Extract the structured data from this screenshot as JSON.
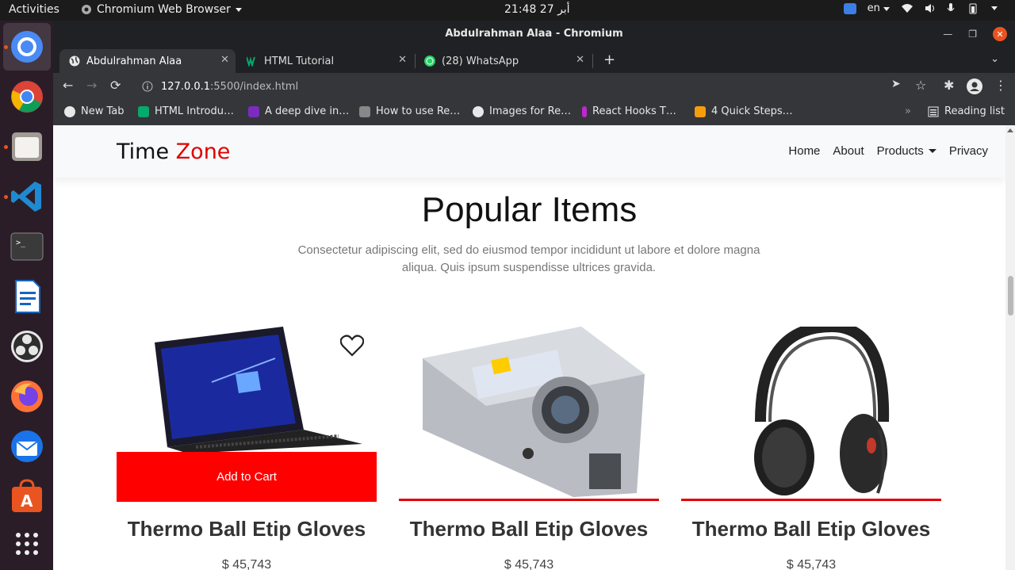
{
  "system": {
    "activities": "Activities",
    "app_menu": "Chromium Web Browser",
    "clock": "21:48  27 أبر",
    "keyboard_layout": "en"
  },
  "dock": {
    "items": [
      {
        "name": "chromium-icon",
        "active": true,
        "running": true
      },
      {
        "name": "chrome-icon",
        "running": false
      },
      {
        "name": "files-icon",
        "running": true
      },
      {
        "name": "vscode-icon",
        "running": true
      },
      {
        "name": "terminal-icon",
        "running": false
      },
      {
        "name": "libreoffice-writer-icon",
        "running": false
      },
      {
        "name": "obs-icon",
        "running": false
      },
      {
        "name": "firefox-icon",
        "running": false
      },
      {
        "name": "thunderbird-icon",
        "running": false
      },
      {
        "name": "software-center-icon",
        "running": false
      },
      {
        "name": "show-apps-icon",
        "running": false
      }
    ]
  },
  "browser": {
    "window_title": "Abdulrahman Alaa - Chromium",
    "tabs": [
      {
        "label": "Abdulrahman Alaa",
        "icon": "globe-icon",
        "active": true
      },
      {
        "label": "HTML Tutorial",
        "icon": "w3schools-icon",
        "active": false
      },
      {
        "label": "(28) WhatsApp",
        "icon": "whatsapp-icon",
        "active": false
      }
    ],
    "url_host": "127.0.0.1",
    "url_rest": ":5500/index.html",
    "bookmarks": [
      {
        "label": "New Tab",
        "icon": "globe-icon",
        "color": "#e8e8e8"
      },
      {
        "label": "HTML Introdu…",
        "icon": "w3schools-icon",
        "color": "#04aa6d"
      },
      {
        "label": "A deep dive in…",
        "icon": "rocket-icon",
        "color": "#7b2cbf"
      },
      {
        "label": "How to use Re…",
        "icon": "koala-icon",
        "color": "#888888"
      },
      {
        "label": "Images for Re…",
        "icon": "globe-icon",
        "color": "#e8e8e8"
      },
      {
        "label": "React Hooks T…",
        "icon": "info-icon",
        "color": "#c026d3"
      },
      {
        "label": "4 Quick Steps…",
        "icon": "hashnode-icon",
        "color": "#f59e0b"
      }
    ],
    "reading_list": "Reading list"
  },
  "page": {
    "brand_first": "Time ",
    "brand_second": "Zone",
    "nav": {
      "home": "Home",
      "about": "About",
      "products": "Products",
      "privacy": "Privacy"
    },
    "heading": "Popular Items",
    "subtext": "Consectetur adipiscing elit, sed do eiusmod tempor incididunt ut labore et dolore magna aliqua. Quis ipsum suspendisse ultrices gravida.",
    "products": [
      {
        "name": "Thermo Ball Etip Gloves",
        "price": "$ 45,743",
        "image": "laptop",
        "hovered": true,
        "add_to_cart": "Add to Cart"
      },
      {
        "name": "Thermo Ball Etip Gloves",
        "price": "$ 45,743",
        "image": "camera",
        "hovered": false
      },
      {
        "name": "Thermo Ball Etip Gloves",
        "price": "$ 45,743",
        "image": "headphones",
        "hovered": false
      }
    ],
    "accent_color": "#ff0000"
  }
}
